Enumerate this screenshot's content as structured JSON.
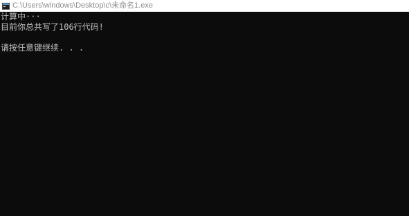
{
  "window": {
    "title": "C:\\Users\\windows\\Desktop\\c\\未命名1.exe",
    "icon": "console-app-icon"
  },
  "console": {
    "lines": [
      "计算中···",
      "目前你总共写了106行代码!",
      "",
      "请按任意键继续. . ."
    ]
  },
  "colors": {
    "background": "#0c0c0c",
    "text": "#c0c0c0",
    "titlebar": "#ffffff",
    "title_text": "#8c8c8c"
  }
}
